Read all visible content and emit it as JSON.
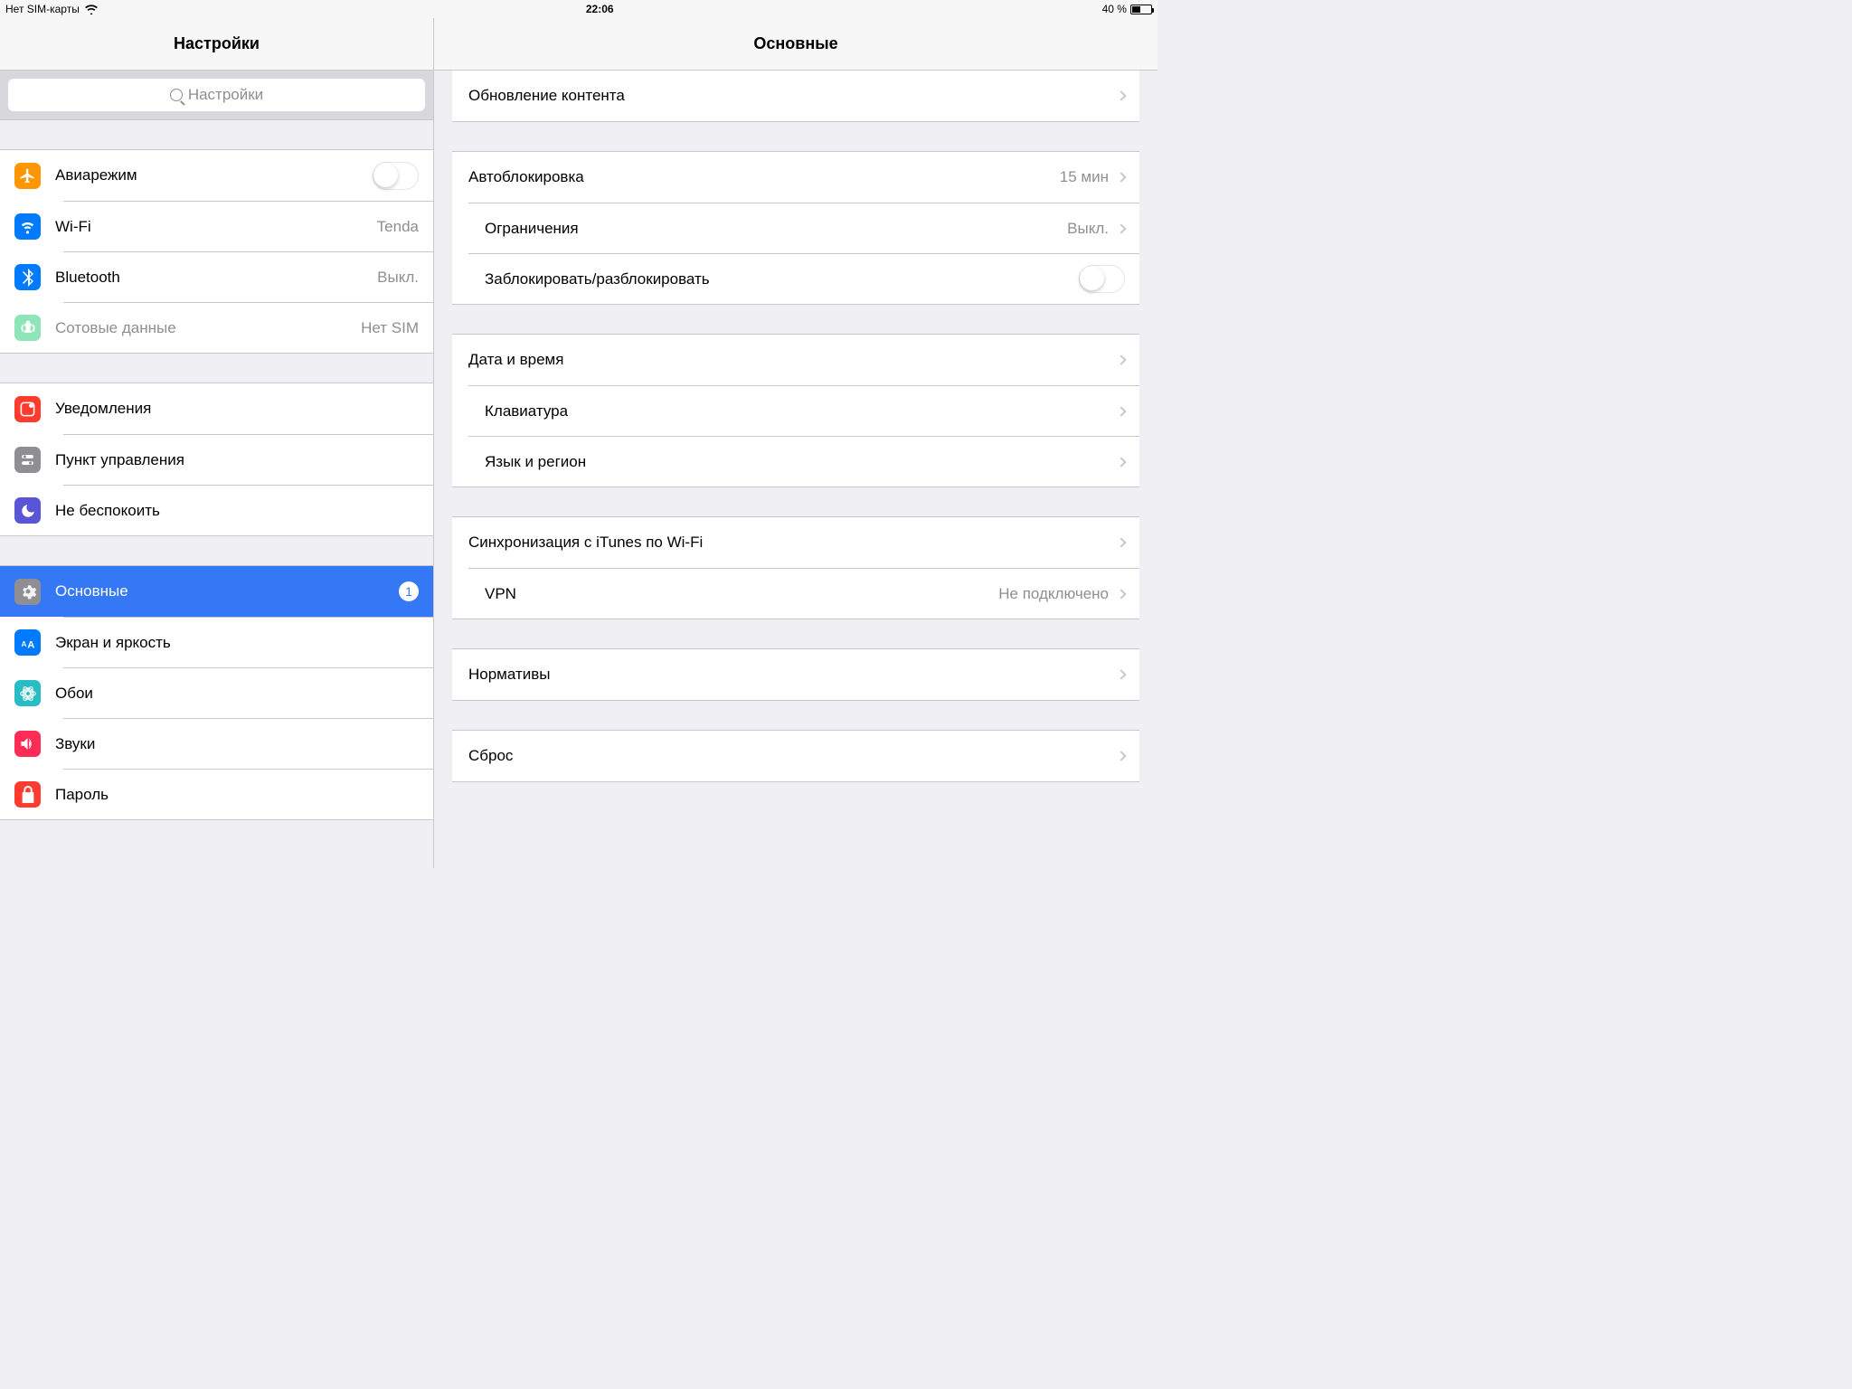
{
  "status_bar": {
    "carrier": "Нет SIM-карты",
    "time": "22:06",
    "battery_text": "40 %"
  },
  "sidebar": {
    "title": "Настройки",
    "search_placeholder": "Настройки",
    "groups": [
      [
        {
          "icon": "airplane",
          "color": "#ff9500",
          "label": "Авиарежим",
          "type": "toggle",
          "on": false
        },
        {
          "icon": "wifi",
          "color": "#007aff",
          "label": "Wi-Fi",
          "value": "Tenda"
        },
        {
          "icon": "bluetooth",
          "color": "#007aff",
          "label": "Bluetooth",
          "value": "Выкл."
        },
        {
          "icon": "cellular",
          "color": "#8ee6b8",
          "label": "Сотовые данные",
          "value": "Нет SIM",
          "disabled": true
        }
      ],
      [
        {
          "icon": "notifications",
          "color": "#ff3b30",
          "label": "Уведомления"
        },
        {
          "icon": "control-center",
          "color": "#8e8e93",
          "label": "Пункт управления"
        },
        {
          "icon": "dnd",
          "color": "#5856d6",
          "label": "Не беспокоить"
        }
      ],
      [
        {
          "icon": "general",
          "color": "#8e8e93",
          "label": "Основные",
          "selected": true,
          "badge": "1"
        },
        {
          "icon": "display",
          "color": "#007aff",
          "label": "Экран и яркость"
        },
        {
          "icon": "wallpaper",
          "color": "#27bdc3",
          "label": "Обои"
        },
        {
          "icon": "sounds",
          "color": "#ff2d55",
          "label": "Звуки"
        },
        {
          "icon": "passcode",
          "color": "#ff3b30",
          "label": "Пароль"
        }
      ]
    ]
  },
  "detail": {
    "title": "Основные",
    "groups": [
      [
        {
          "label": "Обновление контента",
          "chevron": true
        }
      ],
      [
        {
          "label": "Автоблокировка",
          "value": "15 мин",
          "chevron": true
        },
        {
          "label": "Ограничения",
          "value": "Выкл.",
          "chevron": true
        },
        {
          "label": "Заблокировать/разблокировать",
          "type": "toggle",
          "on": false
        }
      ],
      [
        {
          "label": "Дата и время",
          "chevron": true
        },
        {
          "label": "Клавиатура",
          "chevron": true
        },
        {
          "label": "Язык и регион",
          "chevron": true
        }
      ],
      [
        {
          "label": "Синхронизация с iTunes по Wi-Fi",
          "chevron": true
        },
        {
          "label": "VPN",
          "value": "Не подключено",
          "chevron": true
        }
      ],
      [
        {
          "label": "Нормативы",
          "chevron": true
        }
      ],
      [
        {
          "label": "Сброс",
          "chevron": true
        }
      ]
    ]
  }
}
